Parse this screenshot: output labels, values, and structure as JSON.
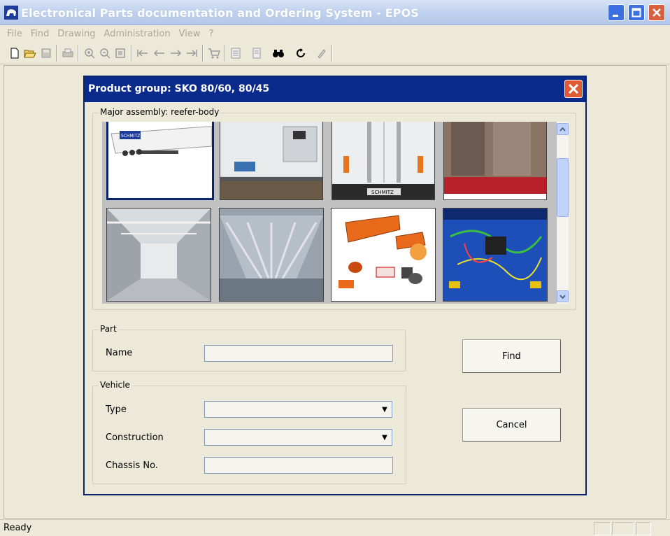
{
  "app": {
    "title": "Electronical Parts documentation and Ordering System - EPOS"
  },
  "menu": [
    "File",
    "Find",
    "Drawing",
    "Administration",
    "View",
    "?"
  ],
  "toolbar": {
    "icons": [
      "new-icon",
      "open-icon",
      "save-icon",
      "print-icon",
      "zoom-in-icon",
      "zoom-out-icon",
      "zoom-fit-icon",
      "first-icon",
      "prev-icon",
      "next-icon",
      "last-icon",
      "cart-icon",
      "list-icon",
      "document-icon",
      "find-binoculars-icon",
      "refresh-icon",
      "edit-icon"
    ]
  },
  "dialog": {
    "title": "Product group: SKO 80/60,  80/45",
    "major_assembly_label": "Major assembly: reefer-body",
    "thumbnails": [
      {
        "name": "trailer",
        "selected": true
      },
      {
        "name": "refrigeration-unit",
        "selected": false
      },
      {
        "name": "rear-doors",
        "selected": false
      },
      {
        "name": "door-detail",
        "selected": false
      },
      {
        "name": "interior-ceiling",
        "selected": false
      },
      {
        "name": "interior-floor",
        "selected": false
      },
      {
        "name": "lights-parts",
        "selected": false
      },
      {
        "name": "wiring",
        "selected": false
      }
    ],
    "part": {
      "group_label": "Part",
      "name_label": "Name",
      "name_value": ""
    },
    "vehicle": {
      "group_label": "Vehicle",
      "type_label": "Type",
      "type_value": "",
      "construction_label": "Construction",
      "construction_value": "",
      "chassis_label": "Chassis No.",
      "chassis_value": ""
    },
    "find_label": "Find",
    "cancel_label": "Cancel"
  },
  "status": {
    "text": "Ready"
  },
  "colors": {
    "dialog_title": "#0b2b8c",
    "close_red": "#e05a34",
    "background": "#ece9d8"
  }
}
